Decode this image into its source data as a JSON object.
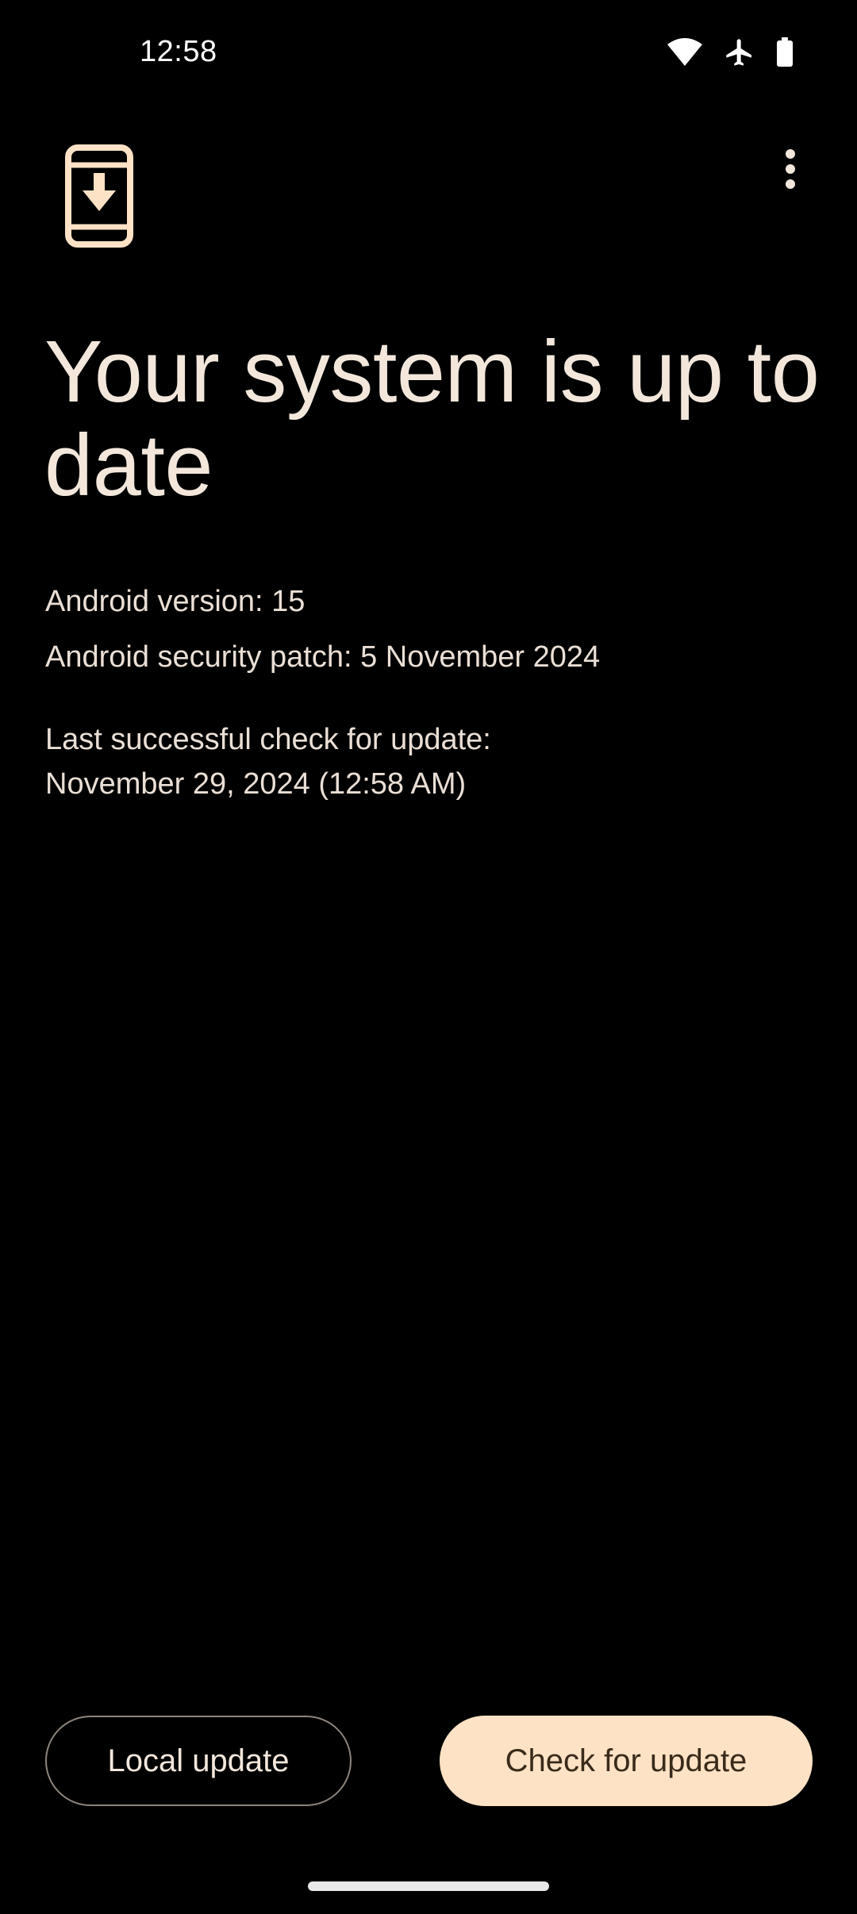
{
  "status_bar": {
    "time": "12:58",
    "icons": [
      "wifi-icon",
      "airplane-mode-icon",
      "battery-icon"
    ],
    "text_color": "#ffffff"
  },
  "header": {
    "app_icon": "system-update-icon",
    "menu_icon": "more-vert-icon"
  },
  "main": {
    "title": "Your system is up to date",
    "android_version": "Android version: 15",
    "security_patch": "Android security patch: 5 November 2024",
    "last_check_line1": "Last successful check for update:",
    "last_check_line2": "November 29, 2024 (12:58 AM)"
  },
  "actions": {
    "local_update_label": "Local update",
    "check_update_label": "Check for update"
  },
  "colors": {
    "background": "#000000",
    "text": "#f3e7dc",
    "accent": "#fde2c5",
    "accent_text": "#3a2a1a",
    "outline": "#8c847c"
  }
}
